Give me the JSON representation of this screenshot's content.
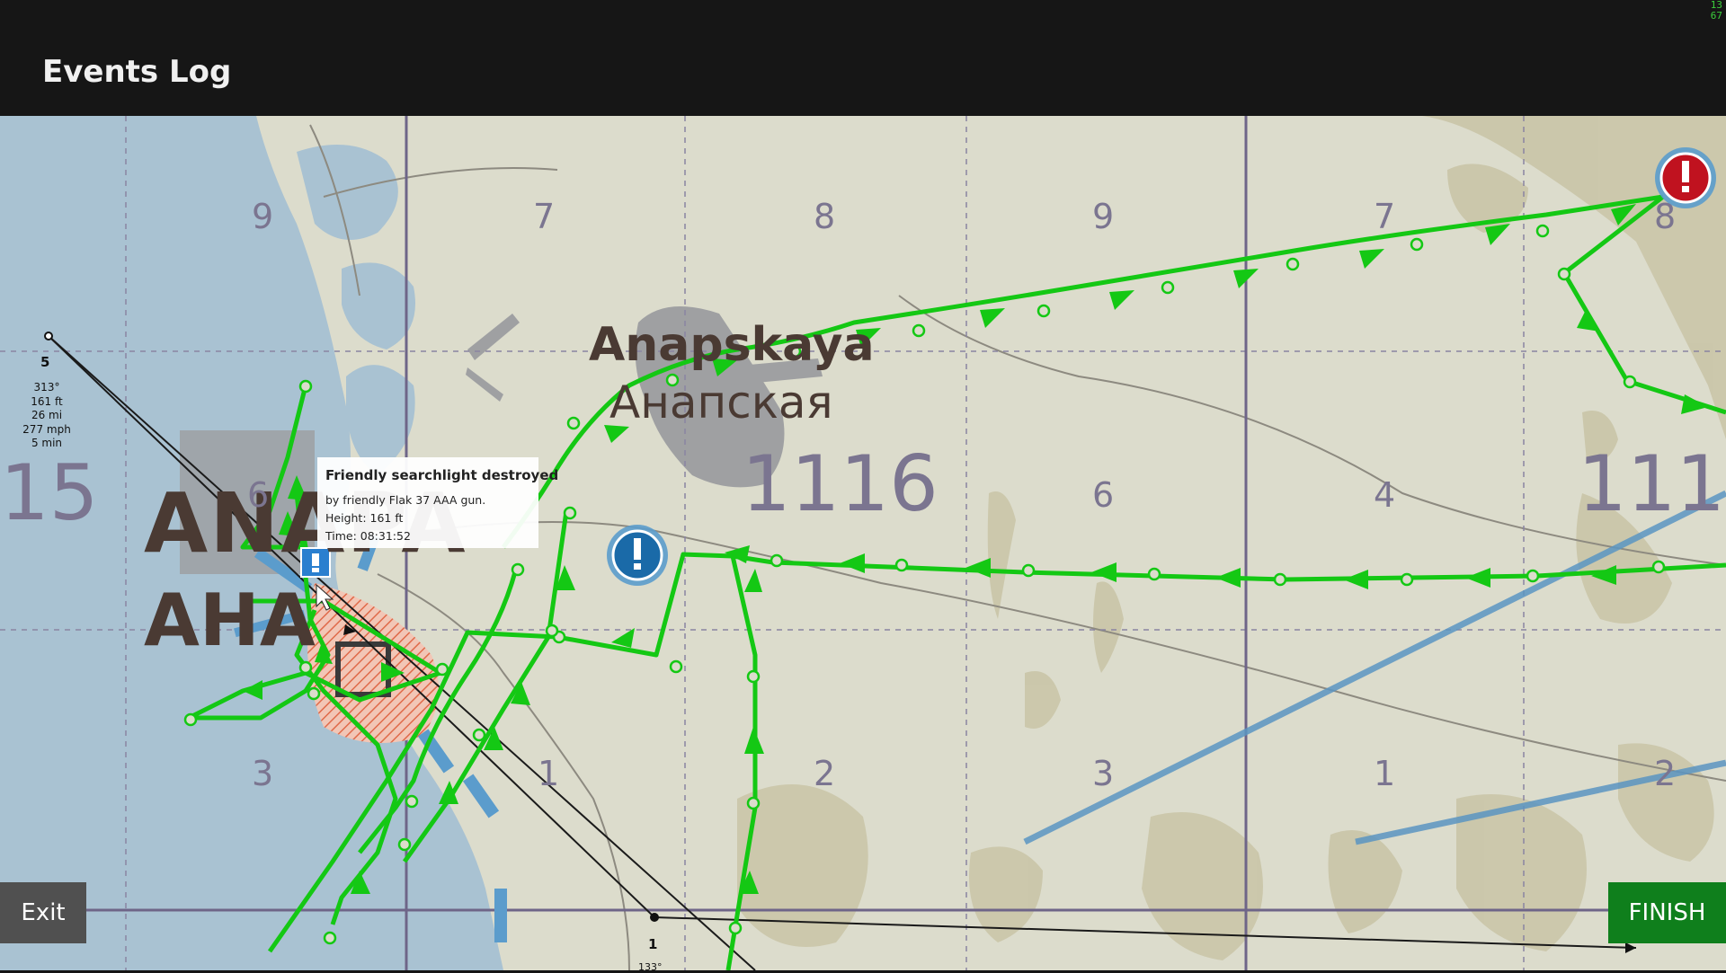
{
  "header": {
    "title": "Events Log",
    "counter_line1": "13",
    "counter_line2": "67"
  },
  "map": {
    "city": {
      "name_en": "Anapskaya",
      "name_ru": "Анапская"
    },
    "town": {
      "name_en": "ANAPA",
      "name_ru": "АНА"
    },
    "grid_labels": {
      "big": [
        "15",
        "1116",
        "111"
      ],
      "small": [
        "9",
        "7",
        "8",
        "9",
        "7",
        "8",
        "6",
        "4",
        "6",
        "3",
        "1",
        "2",
        "3",
        "1",
        "2"
      ]
    }
  },
  "waypoints": {
    "wp5": {
      "number": "5",
      "heading": "313°",
      "height": "161 ft",
      "distance": "26 mi",
      "speed": "277 mph",
      "time": "5 min"
    },
    "wp1": {
      "number": "1",
      "heading": "133°"
    }
  },
  "tooltip": {
    "title": "Friendly searchlight destroyed",
    "line1": "by friendly Flak 37 AAA gun.",
    "line2": "Height: 161 ft",
    "line3": "Time: 08:31:52"
  },
  "buttons": {
    "exit": "Exit",
    "finish": "FINISH"
  },
  "colors": {
    "route_green": "#14c814",
    "friendly_marker": "#1a6aa8",
    "enemy_marker": "#c0121f",
    "finish_bg": "#0f7f1c"
  }
}
